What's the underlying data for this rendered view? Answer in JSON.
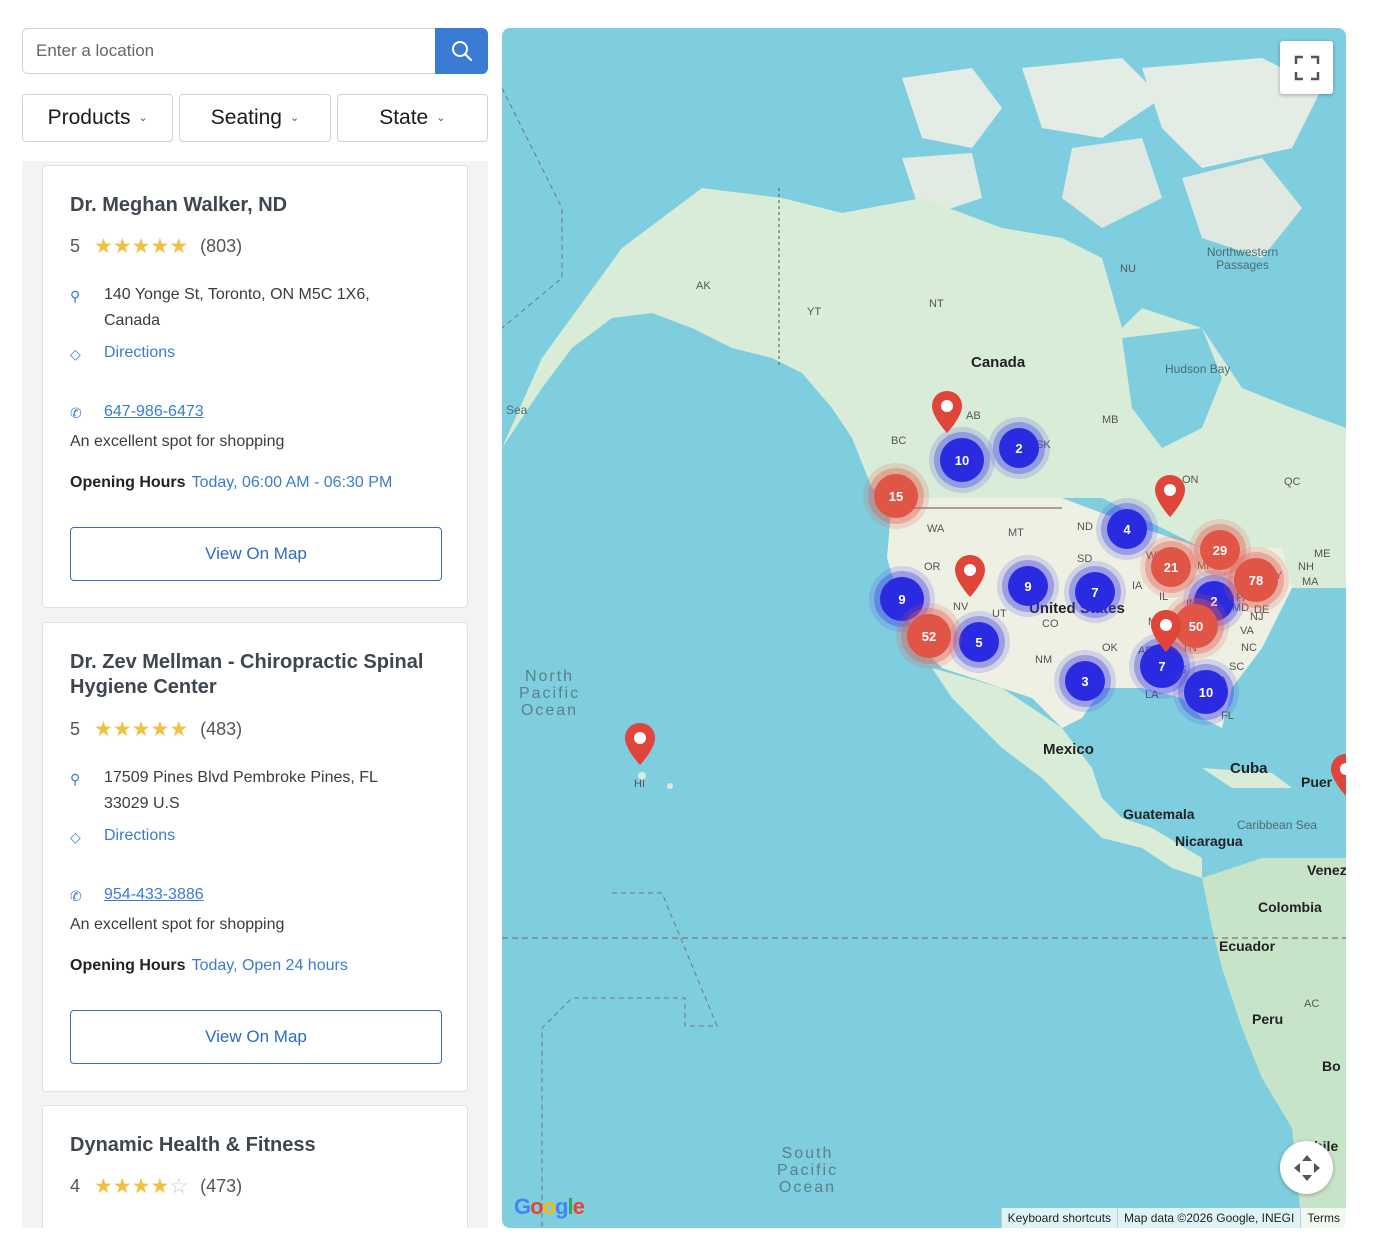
{
  "search": {
    "placeholder": "Enter a location"
  },
  "filters": [
    {
      "label": "Products"
    },
    {
      "label": "Seating"
    },
    {
      "label": "State"
    }
  ],
  "listings": [
    {
      "name": "Dr. Meghan Walker, ND",
      "rating": "5",
      "stars": 5,
      "review_count": "(803)",
      "address": "140 Yonge St, Toronto, ON M5C 1X6, Canada",
      "directions_label": "Directions",
      "phone": "647-986-6473",
      "description": "An excellent spot for shopping",
      "hours_label": "Opening Hours",
      "hours_value": "Today, 06:00 AM - 06:30 PM",
      "button_label": "View On Map"
    },
    {
      "name": "Dr. Zev Mellman - Chiropractic Spinal Hygiene Center",
      "rating": "5",
      "stars": 5,
      "review_count": "(483)",
      "address": "17509 Pines Blvd Pembroke Pines, FL 33029 U.S",
      "directions_label": "Directions",
      "phone": "954-433-3886",
      "description": "An excellent spot for shopping",
      "hours_label": "Opening Hours",
      "hours_value": "Today, Open 24 hours",
      "button_label": "View On Map"
    },
    {
      "name": "Dynamic Health & Fitness",
      "rating": "4",
      "stars": 4,
      "review_count": "(473)"
    }
  ],
  "map": {
    "labels": {
      "canada": "Canada",
      "us": "United States",
      "mexico": "Mexico",
      "cuba": "Cuba",
      "guatemala": "Guatemala",
      "nicaragua": "Nicaragua",
      "colombia": "Colombia",
      "ecuador": "Ecuador",
      "peru": "Peru",
      "venezuela": "Venez",
      "puerto": "Puer",
      "hudson": "Hudson Bay",
      "nw_passages": "Northwestern Passages",
      "caribbean": "Caribbean Sea",
      "sea": "Sea",
      "north_pacific": "North Pacific Ocean",
      "south_pacific": "South Pacific Ocean",
      "chile": "Chile",
      "bo": "Bo"
    },
    "states": [
      "AK",
      "YT",
      "NT",
      "NU",
      "BC",
      "AB",
      "SK",
      "MB",
      "ON",
      "QC",
      "WA",
      "OR",
      "MT",
      "ND",
      "SD",
      "MN",
      "WI",
      "MI",
      "NY",
      "ME",
      "NH",
      "MA",
      "WY",
      "NE",
      "IA",
      "IL",
      "IN",
      "OH",
      "PA",
      "NV",
      "UT",
      "CA",
      "CO",
      "MO",
      "KY",
      "VA",
      "NC",
      "TN",
      "SC",
      "AR",
      "OK",
      "NM",
      "TX",
      "LA",
      "MS",
      "AL",
      "GA",
      "FL",
      "HI",
      "AC",
      "NJ",
      "DE",
      "MD"
    ],
    "clusters_blue": [
      "10",
      "2",
      "4",
      "9",
      "9",
      "7",
      "2",
      "5",
      "3",
      "7",
      "10"
    ],
    "clusters_red": [
      "15",
      "29",
      "21",
      "78",
      "52",
      "50"
    ],
    "attribution": [
      "Keyboard shortcuts",
      "Map data ©2026 Google, INEGI",
      "Terms"
    ],
    "logo": "Google"
  }
}
